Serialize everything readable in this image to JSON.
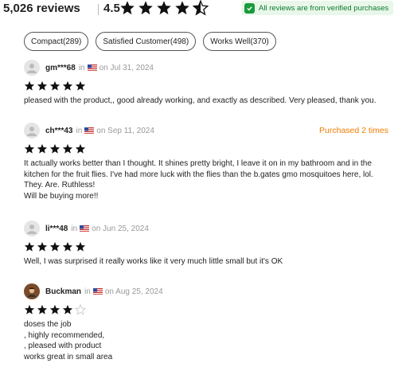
{
  "header": {
    "review_count": "5,026 reviews",
    "rating": "4.5",
    "stars_filled": 4.5,
    "verified_text": "All reviews are from verified purchases"
  },
  "filters": [
    {
      "label": "Compact(289)"
    },
    {
      "label": "Satisfied Customer(498)"
    },
    {
      "label": "Works Well(370)"
    }
  ],
  "reviews": [
    {
      "user": "gm***68",
      "in_text": "in",
      "date": "on Jul 31, 2024",
      "purchased": "",
      "stars": 5,
      "lines": [
        "pleased with the product,, good already working, and exactly as described. Very pleased, thank you."
      ]
    },
    {
      "user": "ch***43",
      "in_text": "in",
      "date": "on Sep 11, 2024",
      "purchased": "Purchased 2 times",
      "stars": 5,
      "lines": [
        "It actually works better than I thought. It shines pretty bright, I leave it on in my bathroom and in the",
        "kitchen for the fruit flies. I've had more luck with the flies than the b.gates gmo mosquitoes here, lol.",
        "They. Are. Ruthless!",
        "Will be buying more!!"
      ]
    },
    {
      "user": "li***48",
      "in_text": "in",
      "date": "on Jun 25, 2024",
      "purchased": "",
      "stars": 5,
      "lines": [
        "Well, I was surprised it really works like it very much little small but it's OK"
      ]
    },
    {
      "user": "Buckman",
      "in_text": "in",
      "date": "on Aug 25, 2024",
      "purchased": "",
      "stars": 4,
      "lines": [
        "doses the job",
        ", highly recommended,",
        ", pleased with product",
        "works great in small area"
      ]
    }
  ],
  "colors": {
    "star": "#111111",
    "star_empty": "#cccccc",
    "verified_bg": "#e9f7ea",
    "verified_text": "#0c7a2c",
    "purchased": "#f07c00"
  }
}
